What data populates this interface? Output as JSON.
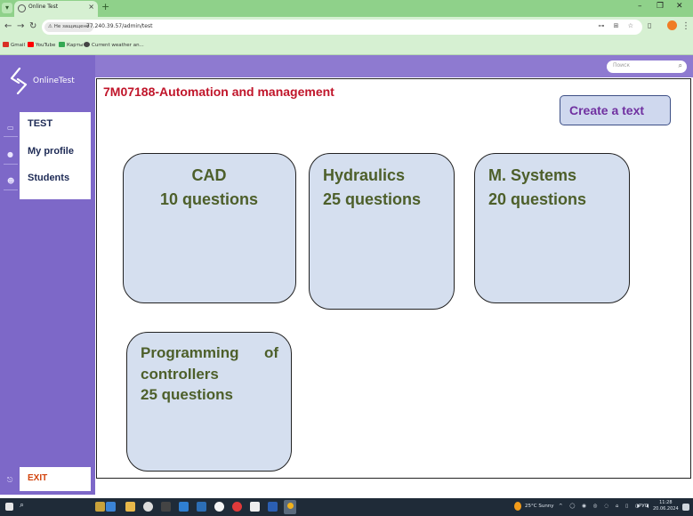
{
  "browser": {
    "tab_title": "Online Test",
    "tab_close": "×",
    "new_tab": "+",
    "window_controls": [
      "–",
      "❐",
      "✕"
    ],
    "security_label": "Не защищено",
    "url": "77.240.39.57/admin/test",
    "bookmarks": [
      {
        "label": "Gmail",
        "color": "#d93025"
      },
      {
        "label": "YouTube",
        "color": "#ff0000"
      },
      {
        "label": "Карты",
        "color": "#34a853"
      },
      {
        "label": "Current weather an...",
        "color": "#444444"
      }
    ]
  },
  "app": {
    "brand": "OnlineTest",
    "search_placeholder": "Поиск",
    "menu": {
      "test": "TEST",
      "profile": "My profile",
      "students": "Students"
    },
    "exit": "EXIT"
  },
  "main": {
    "course_title": "7M07188-Automation and management",
    "create_button": "Create a text",
    "cards": [
      {
        "line1": "CAD",
        "line2": "10 questions"
      },
      {
        "line1": "Hydraulics",
        "line2": "25 questions"
      },
      {
        "line1": "M. Systems",
        "line2": "20 questions"
      },
      {
        "line1a": "Programming",
        "line1b": "of",
        "line2": "controllers",
        "line3": "25 questions"
      }
    ]
  },
  "taskbar": {
    "weather": "25°C  Sunny",
    "lang": "РУС",
    "time": "11:28",
    "date": "20.06.2024"
  },
  "colors": {
    "sidebar": "#7d68c8",
    "header": "#8e7ad0",
    "card_fill": "#d5dfef",
    "title_red": "#c0152a",
    "button_text": "#7030a0",
    "exit_text": "#d2430c"
  }
}
